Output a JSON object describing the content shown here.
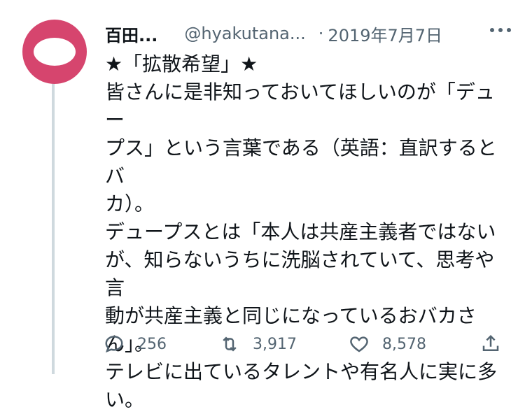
{
  "tweet": {
    "display_name": "百田...",
    "handle": "@hyakutana...",
    "separator": "·",
    "date": "2019年7月7日",
    "body": "★「拡散希望」★\n皆さんに是非知っておいてほしいのが「デュー\nプス」という言葉である（英語：直訳するとバ\nカ）。\nデュープスとは「本人は共産主義者ではない\nが、知らないうちに洗脳されていて、思考や言\n動が共産主義と同じになっているおバカさ\nん」。\nテレビに出ているタレントや有名人に実に多\nい。",
    "avatar_color": "#d6456e"
  },
  "actions": {
    "reply_count": "256",
    "retweet_count": "3,917",
    "like_count": "8,578"
  },
  "icons": {
    "more": "more-icon",
    "reply": "reply-icon",
    "retweet": "retweet-icon",
    "like": "heart-icon",
    "share": "share-icon"
  }
}
